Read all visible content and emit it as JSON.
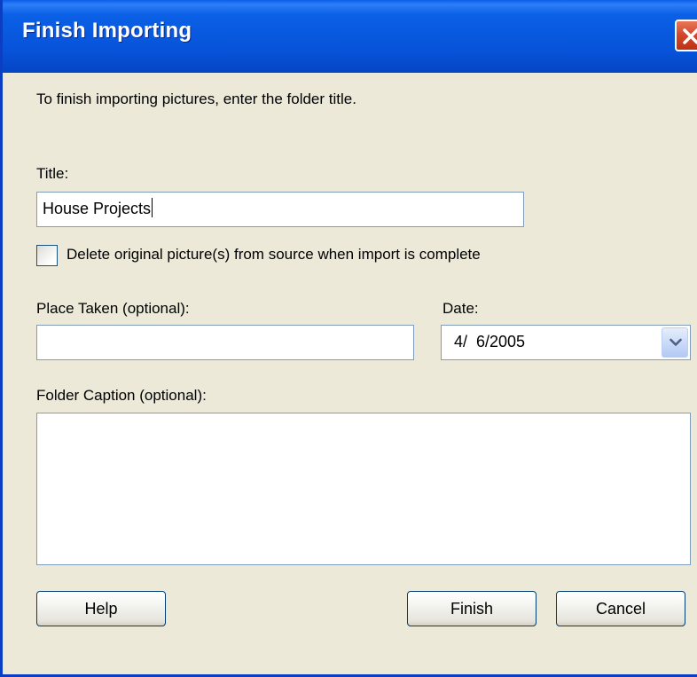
{
  "window": {
    "title": "Finish Importing"
  },
  "instructions": "To finish importing pictures, enter the folder title.",
  "title_field": {
    "label": "Title:",
    "value": "House Projects"
  },
  "delete_option": {
    "label": "Delete original picture(s) from source when import is complete",
    "checked": false
  },
  "place_field": {
    "label": "Place Taken (optional):",
    "value": ""
  },
  "date_field": {
    "label": "Date:",
    "value": "4/  6/2005"
  },
  "caption_field": {
    "label": "Folder Caption (optional):",
    "value": ""
  },
  "buttons": {
    "help": "Help",
    "finish": "Finish",
    "cancel": "Cancel"
  },
  "colors": {
    "titlebar": "#0753d9",
    "dialog_bg": "#ece9d8",
    "close_button": "#d2452a",
    "field_border": "#7f9db9"
  },
  "icons": {
    "close": "close-icon",
    "dropdown": "chevron-down-icon"
  }
}
